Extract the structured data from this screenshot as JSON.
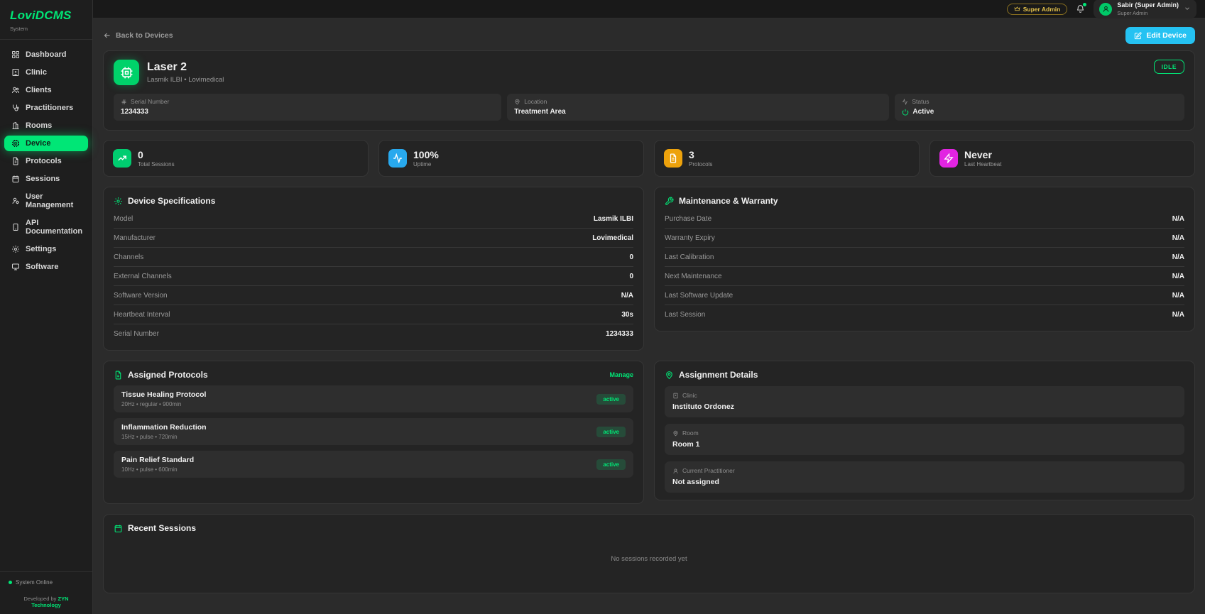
{
  "colors": {
    "accent_green": "#00e676",
    "edit_button_cyan": "#25c2f2",
    "role_badge_gold": "#e3c14b",
    "stat_green": "#00cd70",
    "stat_blue": "#28a9ee",
    "stat_amber": "#eda20c",
    "stat_magenta": "#e224e2"
  },
  "app": {
    "name": "LoviDCMS",
    "tagline": "System"
  },
  "sidebar": {
    "items": [
      {
        "icon": "dashboard-icon",
        "label": "Dashboard"
      },
      {
        "icon": "clinic-icon",
        "label": "Clinic"
      },
      {
        "icon": "clients-icon",
        "label": "Clients"
      },
      {
        "icon": "practitioners-icon",
        "label": "Practitioners"
      },
      {
        "icon": "rooms-icon",
        "label": "Rooms"
      },
      {
        "icon": "device-icon",
        "label": "Device",
        "active": true
      },
      {
        "icon": "protocols-icon",
        "label": "Protocols"
      },
      {
        "icon": "sessions-icon",
        "label": "Sessions"
      },
      {
        "icon": "user-management-icon",
        "label": "User Management"
      },
      {
        "icon": "api-documentation-icon",
        "label": "API Documentation"
      },
      {
        "icon": "settings-icon",
        "label": "Settings"
      },
      {
        "icon": "software-icon",
        "label": "Software"
      }
    ],
    "footer": {
      "status": "System Online",
      "developed_by": "Developed by",
      "developer": "ZYN Technology"
    }
  },
  "topbar": {
    "role_badge": "Super Admin",
    "user_name": "Sabir (Super Admin)",
    "user_role": "Super Admin"
  },
  "page": {
    "back_link": "Back to Devices",
    "edit_button": "Edit Device",
    "device": {
      "name": "Laser 2",
      "subtitle": "Lasmik ILBI • Lovimedical",
      "state_badge": "IDLE",
      "info": [
        {
          "icon": "serial-icon",
          "label": "Serial Number",
          "value": "1234333"
        },
        {
          "icon": "map-pin-icon",
          "label": "Location",
          "value": "Treatment Area"
        },
        {
          "icon": "activity-icon",
          "label": "Status",
          "value": "Active"
        }
      ]
    },
    "stats": [
      {
        "icon": "trending-up-icon",
        "value": "0",
        "label": "Total Sessions",
        "color": "#00cd70"
      },
      {
        "icon": "activity-icon",
        "value": "100%",
        "label": "Uptime",
        "color": "#28a9ee"
      },
      {
        "icon": "file-text-icon",
        "value": "3",
        "label": "Protocols",
        "color": "#eda20c"
      },
      {
        "icon": "zap-icon",
        "value": "Never",
        "label": "Last Heartbeat",
        "color": "#e224e2"
      }
    ],
    "specs": {
      "title": "Device Specifications",
      "rows": [
        [
          "Model",
          "Lasmik ILBI"
        ],
        [
          "Manufacturer",
          "Lovimedical"
        ],
        [
          "Channels",
          "0"
        ],
        [
          "External Channels",
          "0"
        ],
        [
          "Software Version",
          "N/A"
        ],
        [
          "Heartbeat Interval",
          "30s"
        ],
        [
          "Serial Number",
          "1234333"
        ]
      ]
    },
    "maintenance": {
      "title": "Maintenance & Warranty",
      "rows": [
        [
          "Purchase Date",
          "N/A"
        ],
        [
          "Warranty Expiry",
          "N/A"
        ],
        [
          "Last Calibration",
          "N/A"
        ],
        [
          "Next Maintenance",
          "N/A"
        ],
        [
          "Last Software Update",
          "N/A"
        ],
        [
          "Last Session",
          "N/A"
        ]
      ]
    },
    "protocols": {
      "title": "Assigned Protocols",
      "manage_label": "Manage",
      "items": [
        {
          "name": "Tissue Healing Protocol",
          "meta": "20Hz • regular • 900min",
          "status": "active"
        },
        {
          "name": "Inflammation Reduction",
          "meta": "15Hz • pulse • 720min",
          "status": "active"
        },
        {
          "name": "Pain Relief Standard",
          "meta": "10Hz • pulse • 600min",
          "status": "active"
        }
      ]
    },
    "assignment": {
      "title": "Assignment Details",
      "items": [
        {
          "icon": "clinic-icon",
          "label": "Clinic",
          "value": "Instituto Ordonez"
        },
        {
          "icon": "map-pin-icon",
          "label": "Room",
          "value": "Room 1"
        },
        {
          "icon": "user-icon",
          "label": "Current Practitioner",
          "value": "Not assigned"
        }
      ]
    },
    "sessions": {
      "title": "Recent Sessions",
      "empty_message": "No sessions recorded yet"
    }
  }
}
